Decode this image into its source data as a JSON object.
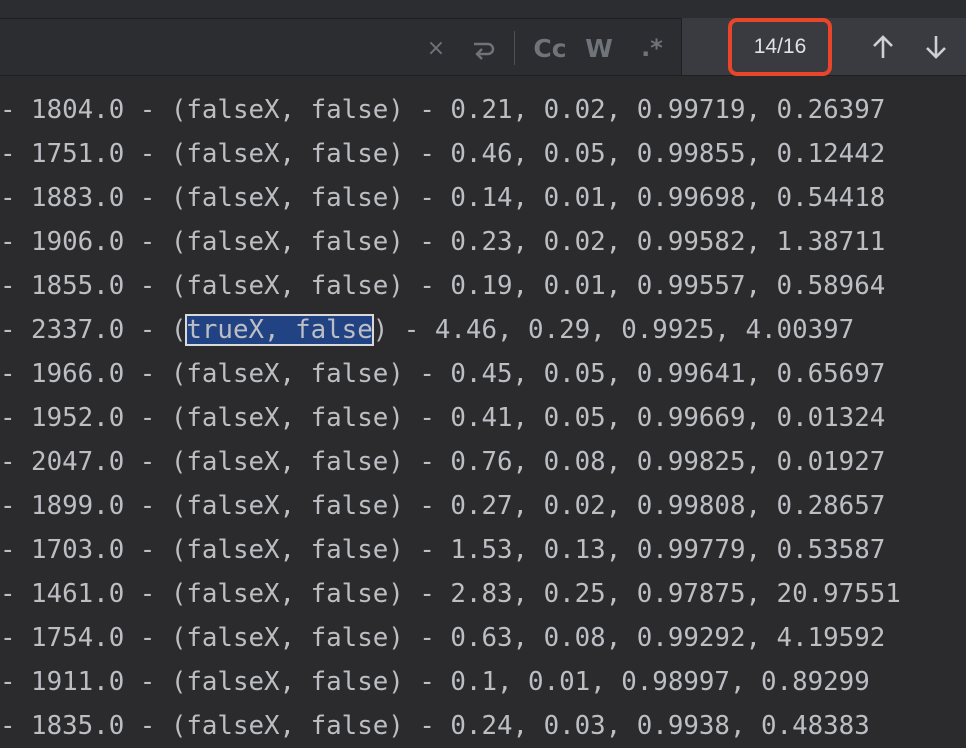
{
  "find_bar": {
    "search_value": "",
    "match_counter": "14/16",
    "options": {
      "match_case": "Cc",
      "words": "W",
      "regex": ".*"
    },
    "icons": {
      "clear": "close-icon",
      "replace_toggle": "replace-icon",
      "prev": "arrow-up-icon",
      "next": "arrow-down-icon"
    },
    "highlight_color": "#e8452a"
  },
  "editor": {
    "selection_color": "#214283",
    "lines": [
      {
        "prefix": "- 1804.0 - (",
        "match": "falseX, false",
        "suffix": ") - 0.21, 0.02, 0.99719, 0.26397",
        "current": false
      },
      {
        "prefix": "- 1751.0 - (",
        "match": "falseX, false",
        "suffix": ") - 0.46, 0.05, 0.99855, 0.12442",
        "current": false
      },
      {
        "prefix": "- 1883.0 - (",
        "match": "falseX, false",
        "suffix": ") - 0.14, 0.01, 0.99698, 0.54418",
        "current": false
      },
      {
        "prefix": "- 1906.0 - (",
        "match": "falseX, false",
        "suffix": ") - 0.23, 0.02, 0.99582, 1.38711",
        "current": false
      },
      {
        "prefix": "- 1855.0 - (",
        "match": "falseX, false",
        "suffix": ") - 0.19, 0.01, 0.99557, 0.58964",
        "current": false
      },
      {
        "prefix": "- 2337.0 - (",
        "match": "trueX, false",
        "suffix": ") - 4.46, 0.29, 0.9925, 4.00397",
        "current": true
      },
      {
        "prefix": "- 1966.0 - (",
        "match": "falseX, false",
        "suffix": ") - 0.45, 0.05, 0.99641, 0.65697",
        "current": false
      },
      {
        "prefix": "- 1952.0 - (",
        "match": "falseX, false",
        "suffix": ") - 0.41, 0.05, 0.99669, 0.01324",
        "current": false
      },
      {
        "prefix": "- 2047.0 - (",
        "match": "falseX, false",
        "suffix": ") - 0.76, 0.08, 0.99825, 0.01927",
        "current": false
      },
      {
        "prefix": "- 1899.0 - (",
        "match": "falseX, false",
        "suffix": ") - 0.27, 0.02, 0.99808, 0.28657",
        "current": false
      },
      {
        "prefix": "- 1703.0 - (",
        "match": "falseX, false",
        "suffix": ") - 1.53, 0.13, 0.99779, 0.53587",
        "current": false
      },
      {
        "prefix": "- 1461.0 - (",
        "match": "falseX, false",
        "suffix": ") - 2.83, 0.25, 0.97875, 20.97551",
        "current": false
      },
      {
        "prefix": "- 1754.0 - (",
        "match": "falseX, false",
        "suffix": ") - 0.63, 0.08, 0.99292, 4.19592",
        "current": false
      },
      {
        "prefix": "- 1911.0 - (",
        "match": "falseX, false",
        "suffix": ") - 0.1, 0.01, 0.98997, 0.89299",
        "current": false
      },
      {
        "prefix": "- 1835.0 - (",
        "match": "falseX, false",
        "suffix": ") - 0.24, 0.03, 0.9938, 0.48383",
        "current": false
      }
    ]
  }
}
